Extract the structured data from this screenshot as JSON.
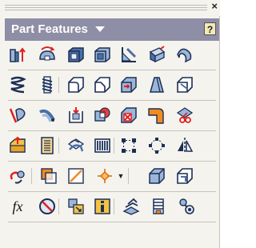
{
  "toolbar": {
    "title": "Part Features",
    "help_label": "?",
    "close_label": "×"
  },
  "fx_label": "fx",
  "icons": [
    [
      "extrude-icon",
      "revolve-icon",
      "shell-icon",
      "thicken-icon",
      "rib-icon",
      "loft-icon",
      "sweep-icon"
    ],
    [
      "coil-icon",
      "thread-icon",
      "fillet-icon",
      "chamfer-icon",
      "hole-icon",
      "draft-icon",
      "split-icon"
    ],
    [
      "face-draft-icon",
      "emboss-icon",
      "decal-icon",
      "combine-icon",
      "delete-face-icon",
      "bend-part-icon",
      "copy-object-icon"
    ],
    [
      "derived-part-icon",
      "table-icon",
      "replace-face-icon",
      "grill-icon",
      "rectangular-pattern-icon",
      "circular-pattern-icon",
      "mirror-icon"
    ],
    [
      "move-face-icon",
      "work-plane-icon",
      "work-axis-icon",
      "work-point-icon",
      "work-point-dropdown-icon",
      "box-icon",
      "solid-body-icon"
    ],
    [
      "parameters-icon",
      "stop-icon",
      "derived-assembly-icon",
      "ifeature-icon",
      "promote-icon",
      "snap-fit-icon",
      "boss-icon"
    ]
  ],
  "colors": {
    "header": "#8e8ea6",
    "panel": "#f5f3ee",
    "accent": "#e02020"
  }
}
